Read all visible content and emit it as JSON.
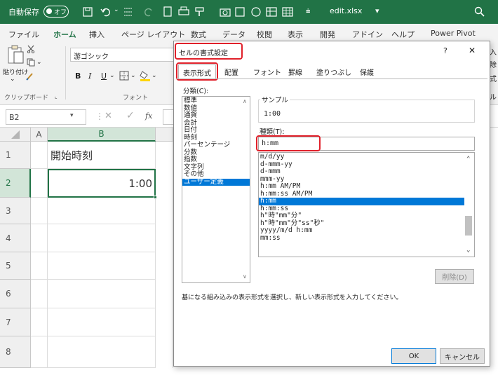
{
  "titlebar": {
    "autosave_label": "自動保存",
    "autosave_state": "オフ",
    "filename": "edit.xlsx",
    "filename_caret": "▾"
  },
  "ribbon_tabs": [
    "ファイル",
    "ホーム",
    "挿入",
    "ページ レイアウト",
    "数式",
    "データ",
    "校閲",
    "表示",
    "開発",
    "アドイン",
    "ヘルプ",
    "Power Pivot"
  ],
  "ribbon": {
    "paste_label": "貼り付け",
    "clipboard_label": "クリップボード",
    "font_name": "游ゴシック",
    "font_group_label": "フォント",
    "bold": "B",
    "italic": "I",
    "underline": "U",
    "right_edge_labels": [
      "入",
      "除",
      "式",
      "ル"
    ]
  },
  "formula_bar": {
    "name_box": "B2",
    "fx": "fx"
  },
  "sheet": {
    "columns": [
      "A",
      "B"
    ],
    "rows": [
      "1",
      "2",
      "3",
      "4",
      "5",
      "6",
      "7",
      "8"
    ],
    "b1": "開始時刻",
    "b2": "1:00"
  },
  "dialog": {
    "title": "セルの書式設定",
    "help": "?",
    "close": "✕",
    "tabs": [
      "表示形式",
      "配置",
      "フォント",
      "罫線",
      "塗りつぶし",
      "保護"
    ],
    "category_label": "分類(C):",
    "categories": [
      "標準",
      "数値",
      "通貨",
      "会計",
      "日付",
      "時刻",
      "パーセンテージ",
      "分数",
      "指数",
      "文字列",
      "その他",
      "ユーザー定義"
    ],
    "selected_category": "ユーザー定義",
    "sample_label": "サンプル",
    "sample_value": "1:00",
    "type_label": "種類(T):",
    "type_value": "h:mm",
    "formats": [
      "m/d/yy",
      "d-mmm-yy",
      "d-mmm",
      "mmm-yy",
      "h:mm AM/PM",
      "h:mm:ss AM/PM",
      "h:mm",
      "h:mm:ss",
      "h\"時\"mm\"分\"",
      "h\"時\"mm\"分\"ss\"秒\"",
      "yyyy/m/d h:mm",
      "mm:ss"
    ],
    "selected_format": "h:mm",
    "delete_button": "削除(D)",
    "description": "基になる組み込みの表示形式を選択し、新しい表示形式を入力してください。",
    "ok_button": "OK",
    "cancel_button": "キャンセル"
  },
  "colors": {
    "excel_green": "#217346",
    "selection_blue": "#0078d7",
    "highlight_red": "#e0202a"
  }
}
